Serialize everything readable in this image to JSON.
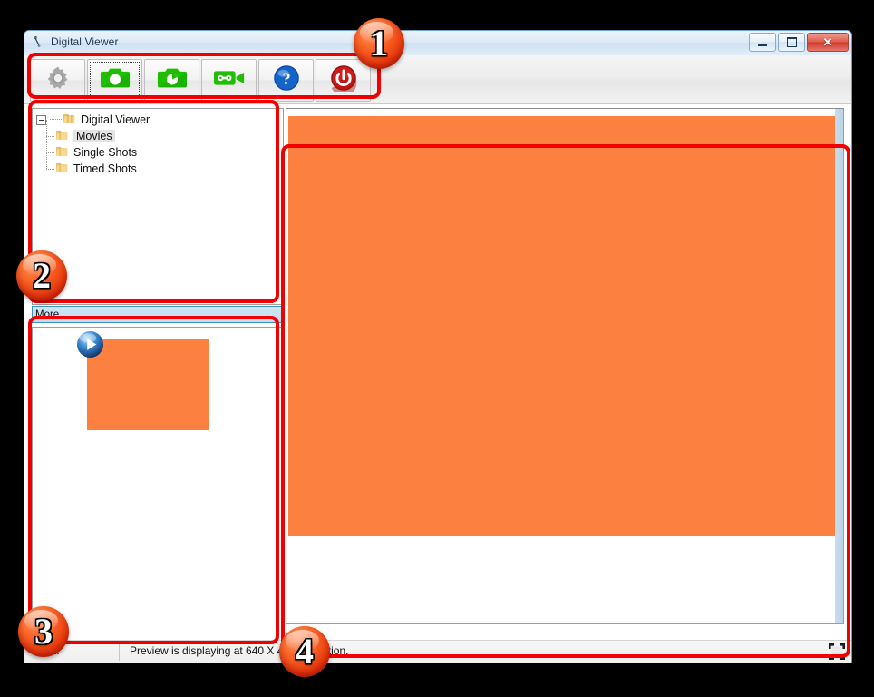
{
  "window": {
    "title": "Digital Viewer",
    "icon": "app-antenna-icon",
    "controls": {
      "minimize_label": "–",
      "maximize_label": "□",
      "close_label": "✕"
    }
  },
  "toolbar": {
    "buttons": [
      {
        "name": "settings-button",
        "icon": "gear-icon",
        "label": "Settings",
        "state": "disabled"
      },
      {
        "name": "single-shot-button",
        "icon": "camera-icon",
        "label": "Single Shot",
        "state": "focused"
      },
      {
        "name": "timed-shot-button",
        "icon": "camera-timer-icon",
        "label": "Timed Shot",
        "state": "normal"
      },
      {
        "name": "movie-button",
        "icon": "video-camera-icon",
        "label": "Movie",
        "state": "normal"
      },
      {
        "name": "help-button",
        "icon": "help-question-icon",
        "label": "Help",
        "state": "normal"
      },
      {
        "name": "power-button",
        "icon": "power-icon",
        "label": "Exit",
        "state": "normal"
      }
    ]
  },
  "tree": {
    "root": {
      "label": "Digital Viewer",
      "icon": "folder-multi-icon",
      "expanded": true
    },
    "children": [
      {
        "label": "Movies",
        "icon": "folder-icon",
        "selected": true
      },
      {
        "label": "Single Shots",
        "icon": "folder-icon",
        "selected": false
      },
      {
        "label": "Timed Shots",
        "icon": "folder-icon",
        "selected": false
      }
    ]
  },
  "more_bar": {
    "label": "More..."
  },
  "thumbnails": {
    "items": [
      {
        "name": "movie-thumbnail",
        "overlay_icon": "play-button-icon",
        "color": "#fc8040"
      }
    ]
  },
  "preview": {
    "color": "#fc8040",
    "scrollbar": "vertical-scrollbar"
  },
  "statusbar": {
    "hint_label": "Hint:",
    "message": "Preview is displaying at 640 X 480 resolution.",
    "grip_icon": "resize-grip-icon"
  },
  "annotations": {
    "badges": [
      {
        "number": "1",
        "target": "toolbar"
      },
      {
        "number": "2",
        "target": "tree-panel"
      },
      {
        "number": "3",
        "target": "thumbnail-panel"
      },
      {
        "number": "4",
        "target": "preview-panel"
      }
    ],
    "color": "#f20000"
  },
  "colors": {
    "accent_orange": "#fc8040",
    "annotation_red": "#f20000",
    "toolbar_green": "#22c404",
    "help_blue": "#1565c9",
    "power_red": "#c81414"
  }
}
